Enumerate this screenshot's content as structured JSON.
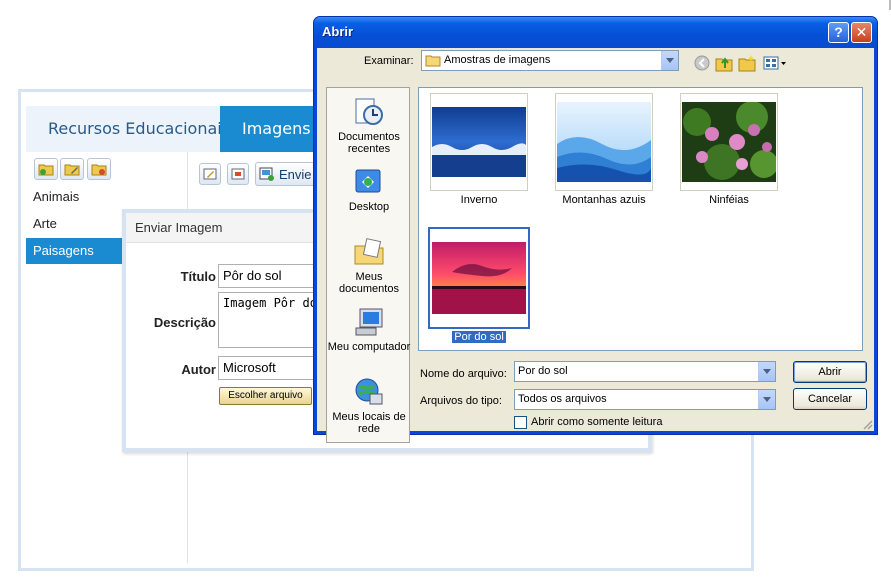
{
  "app": {
    "tabs": [
      "Recursos Educacionais",
      "Imagens"
    ],
    "categories": [
      "Animais",
      "Arte",
      "Paisagens"
    ],
    "envie_label": "Envie"
  },
  "upload_modal": {
    "title": "Enviar Imagem",
    "titulo_label": "Título",
    "titulo_value": "Pôr do sol",
    "descricao_label": "Descrição",
    "descricao_value": "Imagem Pôr do sol",
    "autor_label": "Autor",
    "autor_value": "Microsoft",
    "choose_file_label": "Escolher arquivo"
  },
  "open_dialog": {
    "title": "Abrir",
    "help_symbol": "?",
    "close_symbol": "✕",
    "look_in_label": "Examinar:",
    "look_in_value": "Amostras de imagens",
    "places": [
      "Documentos recentes",
      "Desktop",
      "Meus documentos",
      "Meu computador",
      "Meus locais de rede"
    ],
    "files": [
      {
        "name": "Inverno",
        "selected": false
      },
      {
        "name": "Montanhas azuis",
        "selected": false
      },
      {
        "name": "Ninféias",
        "selected": false
      },
      {
        "name": "Por do sol",
        "selected": true
      }
    ],
    "filename_label": "Nome do arquivo:",
    "filename_value": "Por do sol",
    "filetype_label": "Arquivos do tipo:",
    "filetype_value": "Todos os arquivos",
    "readonly_label": "Abrir como somente leitura",
    "readonly_checked": false,
    "open_button": "Abrir",
    "cancel_button": "Cancelar"
  },
  "colors": {
    "app_accent": "#1a8bd0",
    "xp_title_blue": "#0a5fe4",
    "selection_blue": "#316ac5",
    "dialog_face": "#ece9d8"
  }
}
